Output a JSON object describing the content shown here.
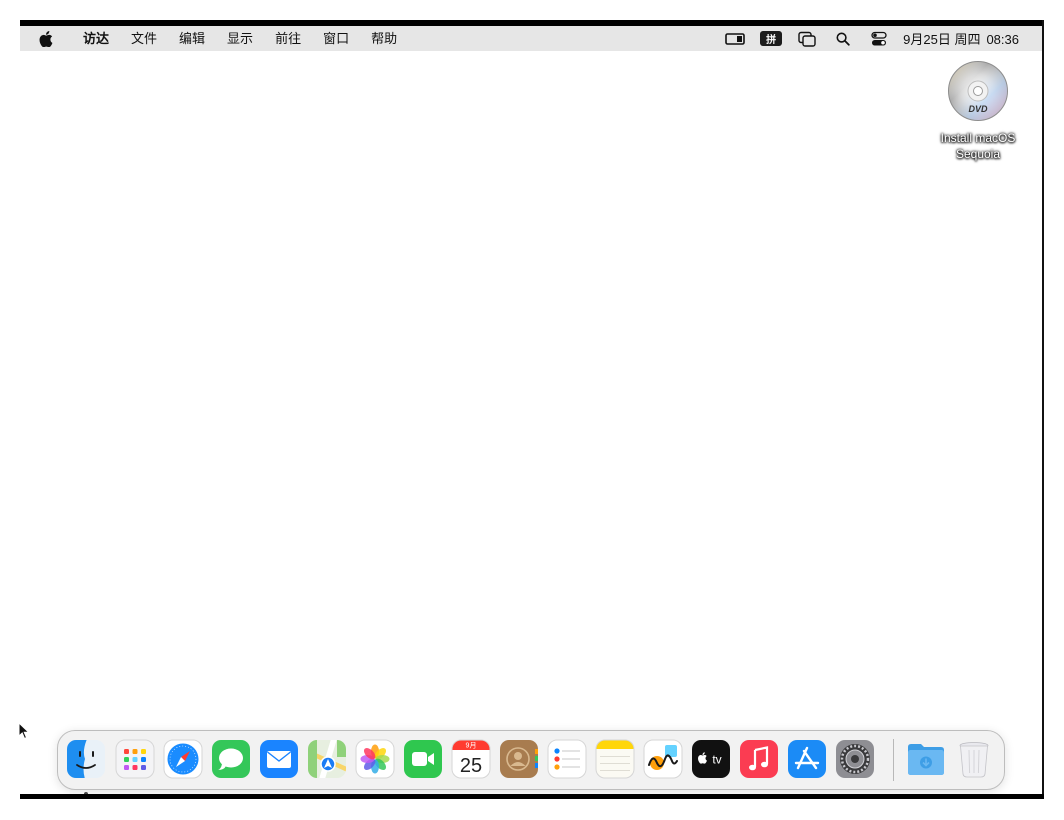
{
  "menubar": {
    "app_name": "访达",
    "menus": [
      "文件",
      "编辑",
      "显示",
      "前往",
      "窗口",
      "帮助"
    ],
    "status_icons": [
      "screen-mirroring-icon",
      "input-method-icon",
      "stage-manager-icon",
      "spotlight-search-icon",
      "control-center-icon"
    ],
    "input_method": "拼",
    "date": "9月25日 周四",
    "time": "08:36"
  },
  "desktop": {
    "icon_name": "dvd-disc-icon",
    "icon_line1": "Install macOS",
    "icon_line2": "Sequoia",
    "dvd_logo": "DVD"
  },
  "dock": {
    "apps": [
      "finder-icon",
      "launchpad-icon",
      "safari-icon",
      "messages-icon",
      "mail-icon",
      "maps-icon",
      "photos-icon",
      "facetime-icon",
      "calendar-icon",
      "contacts-icon",
      "reminders-icon",
      "notes-icon",
      "freeform-icon",
      "apple-tv-icon",
      "music-icon",
      "app-store-icon",
      "system-settings-icon",
      "downloads-folder-icon",
      "trash-icon"
    ],
    "calendar_month": "9月",
    "calendar_day": "25",
    "tv_label": "tv",
    "colors": {
      "finder": "#1e8ef0",
      "safari": "#1a8cff",
      "messages": "#34c759",
      "mail": "#1a84ff",
      "facetime": "#2fc74f",
      "music": "#fb3c52",
      "appstore": "#1b8bf6",
      "tv": "#111111"
    }
  }
}
